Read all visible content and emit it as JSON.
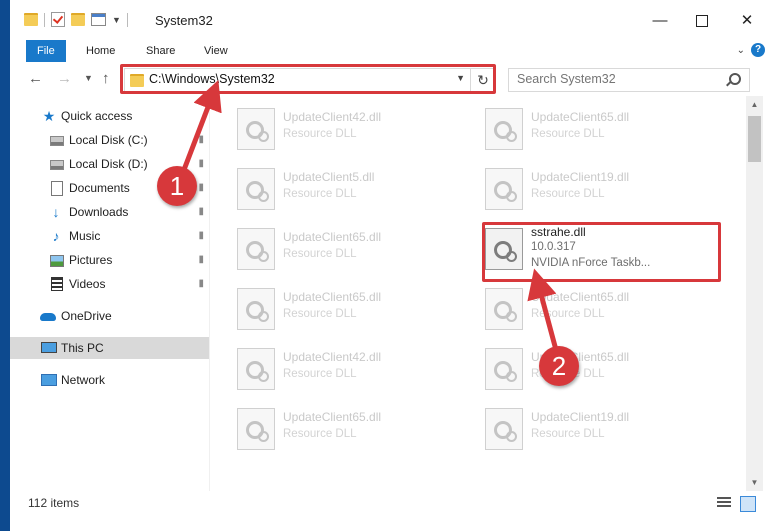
{
  "window": {
    "title": "System32"
  },
  "ribbon": {
    "tabs": [
      "File",
      "Home",
      "Share",
      "View"
    ],
    "help_label": "?"
  },
  "nav": {
    "address": "C:\\Windows\\System32",
    "search_placeholder": "Search System32"
  },
  "sidebar": {
    "items": [
      {
        "label": "Quick access",
        "icon": "star-icon"
      },
      {
        "label": "Local Disk (C:)",
        "icon": "disk-icon",
        "pinned": true
      },
      {
        "label": "Local Disk (D:)",
        "icon": "disk-icon",
        "pinned": true
      },
      {
        "label": "Documents",
        "icon": "documents-icon",
        "pinned": true
      },
      {
        "label": "Downloads",
        "icon": "downloads-icon",
        "pinned": true
      },
      {
        "label": "Music",
        "icon": "music-icon",
        "pinned": true
      },
      {
        "label": "Pictures",
        "icon": "pictures-icon",
        "pinned": true
      },
      {
        "label": "Videos",
        "icon": "videos-icon",
        "pinned": true
      },
      {
        "label": "OneDrive",
        "icon": "onedrive-icon"
      },
      {
        "label": "This PC",
        "icon": "this-pc-icon",
        "selected": true
      },
      {
        "label": "Network",
        "icon": "network-icon"
      }
    ]
  },
  "files": [
    {
      "name": "UpdateClient42.dll",
      "type": "Resource DLL"
    },
    {
      "name": "UpdateClient65.dll",
      "type": "Resource DLL"
    },
    {
      "name": "UpdateClient5.dll",
      "type": "Resource DLL"
    },
    {
      "name": "UpdateClient19.dll",
      "type": "Resource DLL"
    },
    {
      "name": "UpdateClient65.dll",
      "type": "Resource DLL"
    },
    {
      "name": "sstrahe.dll",
      "version": "10.0.317",
      "description": "NVIDIA nForce Taskb...",
      "highlighted": true
    },
    {
      "name": "UpdateClient65.dll",
      "type": "Resource DLL"
    },
    {
      "name": "UpdateClient65.dll",
      "type": "Resource DLL"
    },
    {
      "name": "UpdateClient42.dll",
      "type": "Resource DLL"
    },
    {
      "name": "UpdateClient65.dll",
      "type": "Resource DLL"
    },
    {
      "name": "UpdateClient65.dll",
      "type": "Resource DLL"
    },
    {
      "name": "UpdateClient19.dll",
      "type": "Resource DLL"
    }
  ],
  "status": {
    "item_count": "112 items"
  },
  "annotations": {
    "step1": "1",
    "step2": "2",
    "color": "#d7383b"
  },
  "colors": {
    "accent": "#1979ca",
    "selected_bg": "#d9d9d9"
  }
}
